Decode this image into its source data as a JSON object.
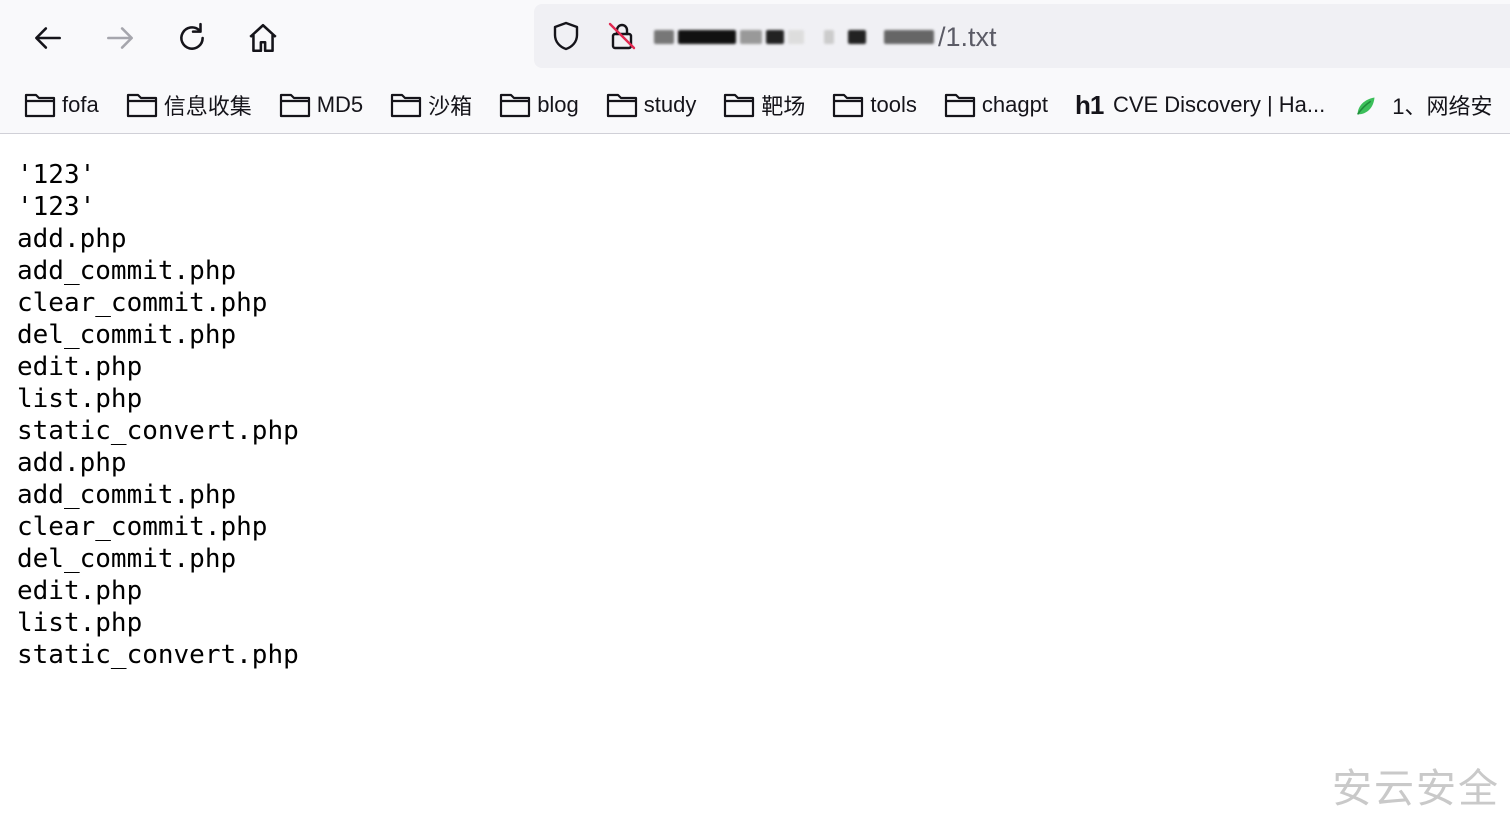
{
  "nav": {
    "back_icon": "arrow-left-icon",
    "forward_icon": "arrow-right-icon",
    "reload_icon": "reload-icon",
    "home_icon": "home-icon"
  },
  "urlbar": {
    "visible_suffix": "/1.txt",
    "shield_icon": "shield-icon",
    "insecure_lock_icon": "lock-slash-icon"
  },
  "bookmarks": [
    {
      "label": "fofa",
      "icon": "folder-icon"
    },
    {
      "label": "信息收集",
      "icon": "folder-icon"
    },
    {
      "label": "MD5",
      "icon": "folder-icon"
    },
    {
      "label": "沙箱",
      "icon": "folder-icon"
    },
    {
      "label": "blog",
      "icon": "folder-icon"
    },
    {
      "label": "study",
      "icon": "folder-icon"
    },
    {
      "label": "靶场",
      "icon": "folder-icon"
    },
    {
      "label": "tools",
      "icon": "folder-icon"
    },
    {
      "label": "chagpt",
      "icon": "folder-icon"
    },
    {
      "label": "CVE Discovery | Ha...",
      "icon": "h1-logo-icon",
      "logo_text": "h1"
    },
    {
      "label": "1、网络安",
      "icon": "green-leaf-icon"
    }
  ],
  "file_lines": [
    "'123'",
    "'123'",
    "add.php",
    "add_commit.php",
    "clear_commit.php",
    "del_commit.php",
    "edit.php",
    "list.php",
    "static_convert.php",
    "add.php",
    "add_commit.php",
    "clear_commit.php",
    "del_commit.php",
    "edit.php",
    "list.php",
    "static_convert.php"
  ],
  "watermark": "安云安全",
  "colors": {
    "chrome_bg": "#f9f9fb",
    "urlbar_bg": "#f0f0f4",
    "icon": "#15141a",
    "insecure_slash": "#e22850"
  }
}
